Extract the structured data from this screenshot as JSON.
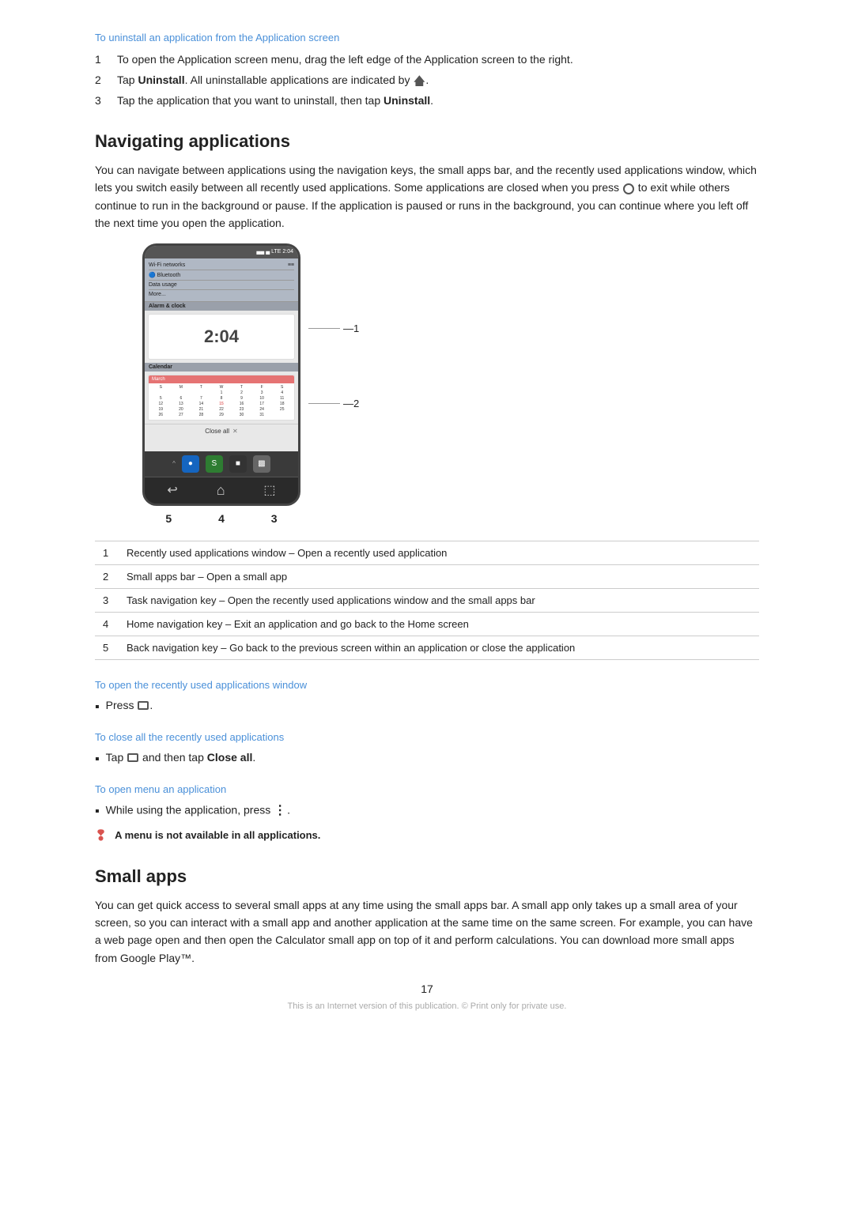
{
  "uninstall_section": {
    "link": "To uninstall an application from the Application screen",
    "steps": [
      {
        "num": "1",
        "text": "To open the Application screen menu, drag the left edge of the Application screen to the right."
      },
      {
        "num": "2",
        "text": "Tap Uninstall. All uninstallable applications are indicated by a home icon."
      },
      {
        "num": "3",
        "text": "Tap the application that you want to uninstall, then tap Uninstall."
      }
    ]
  },
  "navigating_section": {
    "heading": "Navigating applications",
    "body": "You can navigate between applications using the navigation keys, the small apps bar, and the recently used applications window, which lets you switch easily between all recently used applications. Some applications are closed when you press a circle icon to exit while others continue to run in the background or pause. If the application is paused or runs in the background, you can continue where you left off the next time you open the application.",
    "phone_mock": {
      "status_bar": "▄▄ ▄ ▄  LTE 2:04",
      "settings_items": [
        {
          "label": "Wi-Fi networks",
          "value": ""
        },
        {
          "label": "Bluetooth",
          "value": ""
        },
        {
          "label": "Data usage",
          "value": ""
        },
        {
          "label": "More...",
          "value": ""
        }
      ],
      "section_title": "Alarm & clock",
      "clock_time": "2:04",
      "close_all_text": "Close all",
      "close_x": "✕",
      "small_apps": [
        "●",
        "S",
        "■",
        "▩"
      ],
      "nav_icons": [
        "↩",
        "⌂",
        "⬚"
      ],
      "numbers": [
        "5",
        "4",
        "3"
      ]
    },
    "callouts": [
      {
        "num": "1",
        "position": "top"
      },
      {
        "num": "2",
        "position": "middle"
      }
    ],
    "table": [
      {
        "num": "1",
        "text": "Recently used applications window – Open a recently used application"
      },
      {
        "num": "2",
        "text": "Small apps bar – Open a small app"
      },
      {
        "num": "3",
        "text": "Task navigation key – Open the recently used applications window and the small apps bar"
      },
      {
        "num": "4",
        "text": "Home navigation key – Exit an application and go back to the Home screen"
      },
      {
        "num": "5",
        "text": "Back navigation key – Go back to the previous screen within an application or close the application"
      }
    ]
  },
  "recently_used_section": {
    "link": "To open the recently used applications window",
    "bullet": "Press a rect-icon."
  },
  "close_all_section": {
    "link": "To close all the recently used applications",
    "bullet": "Tap a rect-icon and then tap Close all."
  },
  "open_menu_section": {
    "link": "To open menu an application",
    "bullet": "While using the application, press ⋮.",
    "warning": "A menu is not available in all applications."
  },
  "small_apps_section": {
    "heading": "Small apps",
    "body": "You can get quick access to several small apps at any time using the small apps bar. A small app only takes up a small area of your screen, so you can interact with a small app and another application at the same time on the same screen. For example, you can have a web page open and then open the Calculator small app on top of it and perform calculations. You can download more small apps from Google Play™."
  },
  "footer": {
    "page_number": "17",
    "note": "This is an Internet version of this publication. © Print only for private use."
  }
}
